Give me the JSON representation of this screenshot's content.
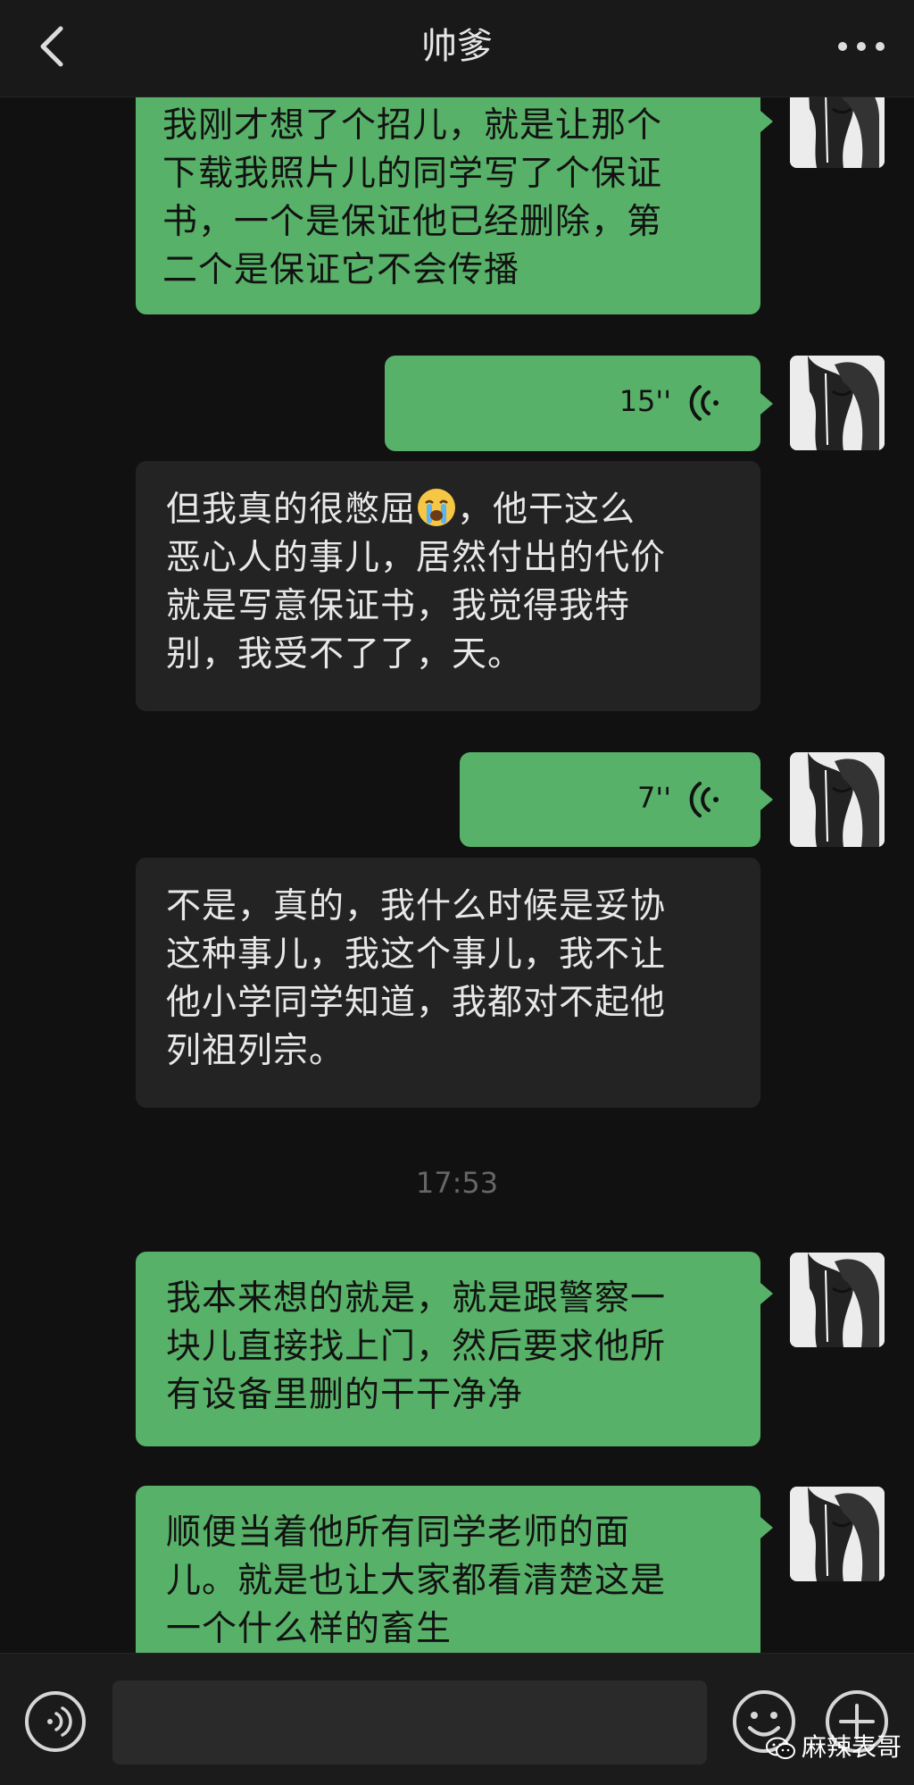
{
  "header": {
    "title": "帅爹",
    "back_icon": "chevron-left-icon",
    "more_icon": "more-dots-icon"
  },
  "messages": [
    {
      "direction": "out",
      "type": "text",
      "text": "我刚才想了个招儿，就是让那个\n下载我照片儿的同学写了个保证\n书，一个是保证他已经删除，第\n二个是保证它不会传播"
    },
    {
      "direction": "out",
      "type": "voice",
      "duration": "15''"
    },
    {
      "direction": "in",
      "type": "text",
      "text_before_emoji": "但我真的很憋屈",
      "emoji": "crying-face-emoji",
      "text_after_emoji": "，他干这么\n恶心人的事儿，居然付出的代价\n就是写意保证书，我觉得我特\n别，我受不了了，天。"
    },
    {
      "direction": "out",
      "type": "voice",
      "duration": "7''"
    },
    {
      "direction": "in",
      "type": "text",
      "text": "不是，真的，我什么时候是妥协\n这种事儿，我这个事儿，我不让\n他小学同学知道，我都对不起他\n列祖列宗。"
    },
    {
      "direction": "out",
      "type": "text",
      "text": "我本来想的就是，就是跟警察一\n块儿直接找上门，然后要求他所\n有设备里删的干干净净"
    },
    {
      "direction": "out",
      "type": "text",
      "text": "顺便当着他所有同学老师的面\n儿。就是也让大家都看清楚这是\n一个什么样的畜生"
    }
  ],
  "timestamp": "17:53",
  "input_bar": {
    "voice_icon": "voice-mode-icon",
    "input_value": "",
    "emoji_icon": "emoji-face-icon",
    "plus_icon": "plus-circle-icon"
  },
  "watermark": {
    "text": "麻辣表哥",
    "icon": "wechat-logo-icon"
  },
  "colors": {
    "outgoing_bubble": "#58b168",
    "incoming_bubble": "#232323",
    "background": "#111111"
  }
}
